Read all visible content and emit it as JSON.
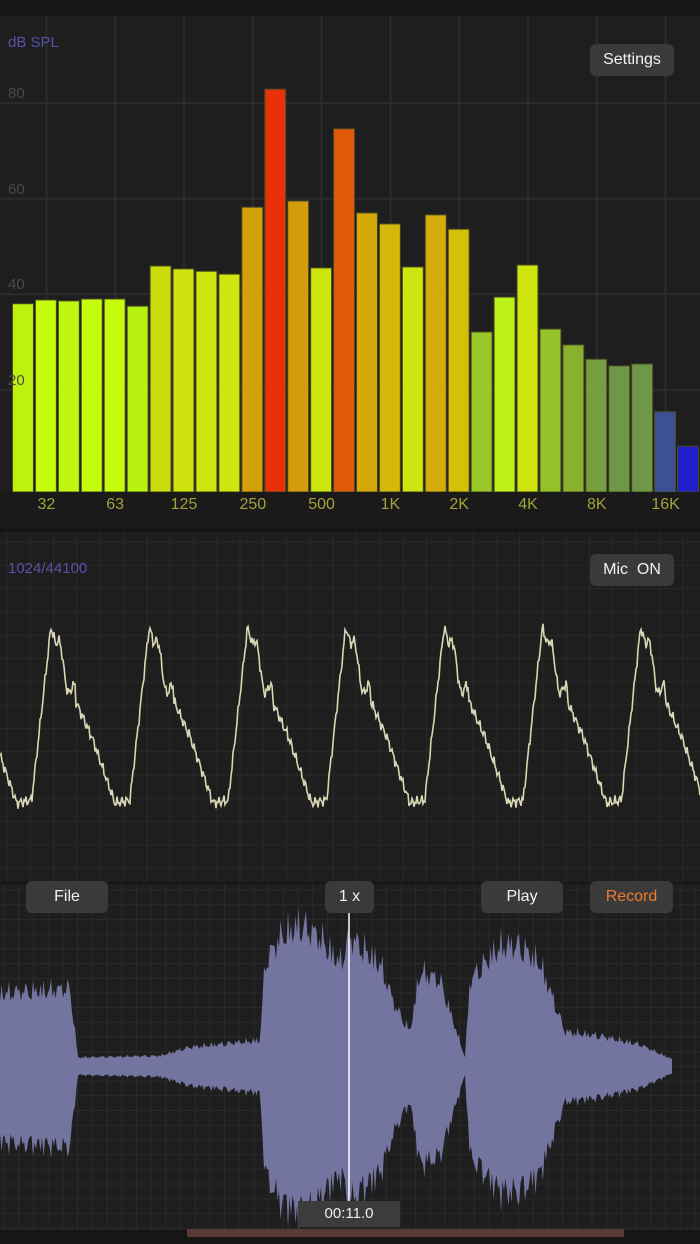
{
  "spectrum": {
    "unit_label": "dB SPL",
    "settings_label": "Settings"
  },
  "scope": {
    "info_label": "1024/44100",
    "mic_label": "Mic  ON"
  },
  "recorder": {
    "file_label": "File",
    "speed_label": "1 x",
    "play_label": "Play",
    "record_label": "Record",
    "time": "00:11.0",
    "record_color": "#f07a2a",
    "waveform_color": "#7474a0"
  },
  "chart_data": {
    "type": "bar",
    "title": "dB SPL",
    "ylabel": "dB SPL",
    "ylim": [
      -1.5,
      100
    ],
    "yticks": [
      "80",
      "60",
      "40",
      "20"
    ],
    "ytick_values": [
      80,
      60,
      40,
      20
    ],
    "xtick_labels": [
      "32",
      "63",
      "125",
      "250",
      "500",
      "1K",
      "2K",
      "4K",
      "8K",
      "16K"
    ],
    "xtick_bar_index": [
      1,
      4,
      7,
      10,
      13,
      16,
      19,
      22,
      25,
      28
    ],
    "values": [
      38,
      38.8,
      38.6,
      39,
      39,
      37.5,
      45.9,
      45.3,
      44.8,
      44.2,
      58.2,
      82.9,
      59.5,
      45.5,
      74.6,
      57,
      54.7,
      45.7,
      56.6,
      53.6,
      32.1,
      39.4,
      46.1,
      32.7,
      29.4,
      26.4,
      25,
      25.4,
      15.4,
      8.2
    ],
    "colors": [
      "#bef20e",
      "#c4fc0c",
      "#bef80e",
      "#c4fc0c",
      "#c4fc0c",
      "#b8f210",
      "#cadc0c",
      "#cde20e",
      "#cfe60e",
      "#cfe60e",
      "#d4a00a",
      "#e8300a",
      "#d49c0a",
      "#cfe60e",
      "#e05a0a",
      "#d4aa0a",
      "#d4b80a",
      "#cfe60e",
      "#d4ac0a",
      "#d4c00a",
      "#98c82a",
      "#bcf21a",
      "#cfe60e",
      "#96c22a",
      "#8ab030",
      "#76a040",
      "#6e9848",
      "#6e9848",
      "#3c5096",
      "#2020c8"
    ]
  }
}
